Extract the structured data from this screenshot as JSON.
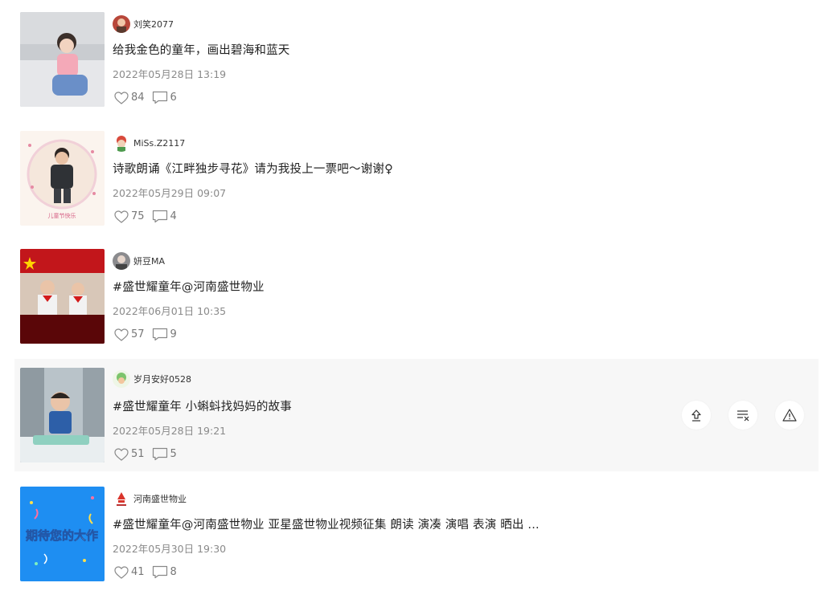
{
  "videos": [
    {
      "username": "刘笑2077",
      "title": "给我金色的童年，画出碧海和蓝天",
      "date": "2022年05月28日 13:19",
      "likes": "84",
      "comments": "6"
    },
    {
      "username": "MiSs.Z2117",
      "title": "诗歌朗诵《江畔独步寻花》请为我投上一票吧～谢谢♀",
      "date": "2022年05月29日 09:07",
      "likes": "75",
      "comments": "4"
    },
    {
      "username": "妍豆MA",
      "title": "#盛世耀童年@河南盛世物业",
      "date": "2022年06月01日 10:35",
      "likes": "57",
      "comments": "9"
    },
    {
      "username": "岁月安好0528",
      "title": "#盛世耀童年 小蝌蚪找妈妈的故事",
      "date": "2022年05月28日 19:21",
      "likes": "51",
      "comments": "5"
    },
    {
      "username": "河南盛世物业",
      "title": "#盛世耀童年@河南盛世物业 亚星盛世物业视频征集 朗读 演凑 演唱 表演 晒出 ...",
      "date": "2022年05月30日 19:30",
      "likes": "41",
      "comments": "8"
    }
  ],
  "thumb5_text": "期待您的大作",
  "thumb2_caption": "儿童节快乐",
  "icons": {
    "like": "heart-icon",
    "comment": "comment-icon",
    "share": "share-icon",
    "not_interested": "not-interested-icon",
    "report": "report-icon"
  },
  "colors": {
    "hover_bg": "#f7f7f7",
    "date": "#8a8a8a",
    "stat": "#777777"
  }
}
